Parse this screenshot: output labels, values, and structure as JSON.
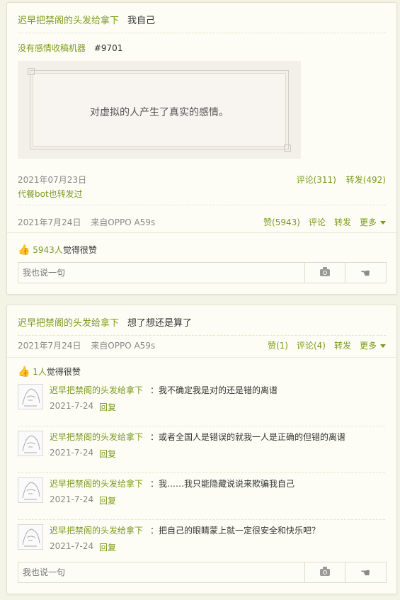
{
  "card1": {
    "header": {
      "author": "迟早把禁阁的头发给拿下",
      "text": "我自己"
    },
    "quoted": {
      "author": "没有感情收稿机器",
      "tag": "#9701",
      "image_text": "对虚拟的人产生了真实的感情。",
      "date": "2021年07月23日",
      "comment_label": "评论(311)",
      "repost_label": "转发(492)",
      "via": "代餐bot也转发过"
    },
    "meta": {
      "date": "2021年7月24日",
      "source": "来自OPPO A59s"
    },
    "actions": {
      "like": "赞(5943)",
      "comment": "评论",
      "repost": "转发",
      "more": "更多"
    },
    "likes": {
      "count": "5943人",
      "suffix": "觉得很赞"
    },
    "input": {
      "placeholder": "我也说一句"
    }
  },
  "card2": {
    "header": {
      "author": "迟早把禁阁的头发给拿下",
      "text": "想了想还是算了"
    },
    "meta": {
      "date": "2021年7月24日",
      "source": "来自OPPO A59s"
    },
    "actions": {
      "like": "赞(1)",
      "comment": "评论(4)",
      "repost": "转发",
      "more": "更多"
    },
    "likes": {
      "count": "1人",
      "suffix": "觉得很赞"
    },
    "comments": [
      {
        "name": "迟早把禁阁的头发给拿下",
        "text": "：我不确定我是对的还是错的离谱",
        "date": "2021-7-24",
        "reply": "回复"
      },
      {
        "name": "迟早把禁阁的头发给拿下",
        "text": "：或者全国人是错误的就我一人是正确的但错的离谱",
        "date": "2021-7-24",
        "reply": "回复"
      },
      {
        "name": "迟早把禁阁的头发给拿下",
        "text": "：我……我只能隐藏说说来欺骗我自己",
        "date": "2021-7-24",
        "reply": "回复"
      },
      {
        "name": "迟早把禁阁的头发给拿下",
        "text": "：把自己的眼睛蒙上就一定很安全和快乐吧？",
        "date": "2021-7-24",
        "reply": "回复"
      }
    ],
    "input": {
      "placeholder": "我也说一句"
    }
  },
  "colors": {
    "accent": "#7a9a1e",
    "card_bg": "#fdfdf5",
    "page_bg": "#f3f3e6",
    "like_blue": "#4a7bd0"
  },
  "icons": {
    "camera": "camera-icon",
    "pointer": "hand-pointer-icon",
    "thumb": "thumbs-up-icon",
    "more": "chevron-down-icon"
  }
}
